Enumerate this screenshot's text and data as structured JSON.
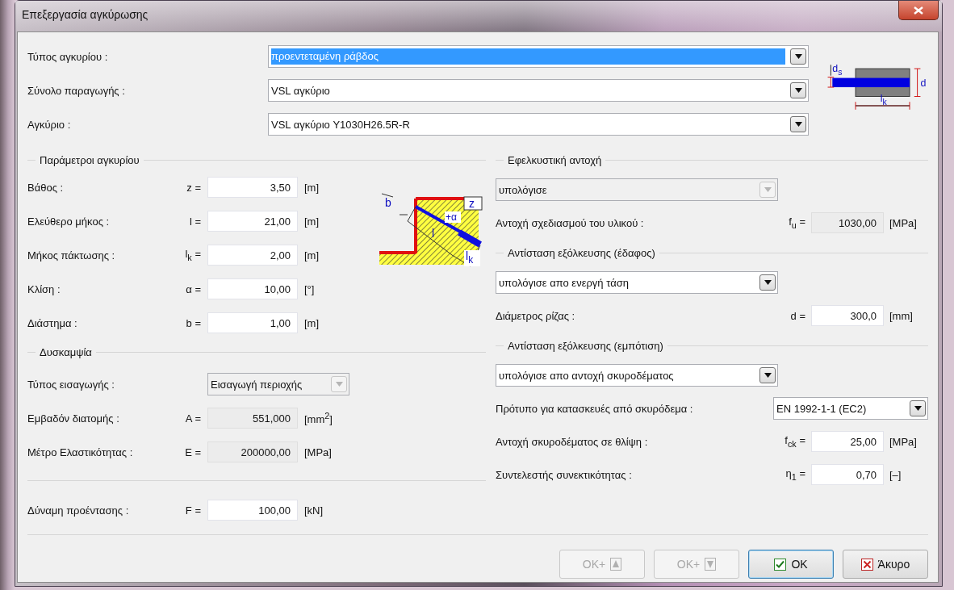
{
  "window": {
    "title": "Επεξεργασία αγκύρωσης"
  },
  "top_fields": [
    {
      "label": "Τύπος αγκυρίου :",
      "value": "προεντεταμένη ράβδος",
      "text_selected": true
    },
    {
      "label": "Σύνολο παραγωγής :",
      "value": "VSL αγκύριο",
      "text_selected": false
    },
    {
      "label": "Αγκύριο :",
      "value": "VSL αγκύριο Y1030H26.5R-R",
      "text_selected": false
    }
  ],
  "section_drawing": {
    "labels": [
      {
        "base": "d",
        "sub": "s"
      },
      {
        "base": "d"
      },
      {
        "base": "l",
        "sub": "k"
      }
    ]
  },
  "anchor_parameters": {
    "title": "Παράμετροι αγκυρίου",
    "rows": [
      {
        "label": "Βάθος :",
        "symbol": "z =",
        "value": "3,50",
        "unit": "[m]"
      },
      {
        "label": "Ελεύθερο μήκος :",
        "symbol": "l =",
        "value": "21,00",
        "unit": "[m]"
      },
      {
        "label": "Μήκος πάκτωσης :",
        "symbol": "l$_{k}$ =",
        "value": "2,00",
        "unit": "[m]"
      },
      {
        "label": "Κλίση :",
        "symbol": "α =",
        "value": "10,00",
        "unit": "[°]"
      },
      {
        "label": "Διάστημα :",
        "symbol": "b =",
        "value": "1,00",
        "unit": "[m]"
      }
    ],
    "diagram_labels": [
      {
        "base": "b"
      },
      {
        "base": "z"
      },
      {
        "base": "+α"
      },
      {
        "base": "l"
      },
      {
        "base": "l",
        "sub": "k"
      }
    ]
  },
  "stiffness": {
    "title": "Δυσκαμψία",
    "input_type": {
      "label": "Τύπος εισαγωγής :",
      "value": "Εισαγωγή περιοχής",
      "disabled": true
    },
    "rows": [
      {
        "label": "Εμβαδόν διατομής :",
        "symbol": "A =",
        "value": "551,000",
        "unit": "[mm$^{2}$]",
        "disabled": true
      },
      {
        "label": "Μέτρο Ελαστικότητας :",
        "symbol": "E =",
        "value": "200000,00",
        "unit": "[MPa]",
        "disabled": true
      }
    ]
  },
  "prestress": {
    "label": "Δύναμη προέντασης :",
    "symbol": "F =",
    "value": "100,00",
    "unit": "[kN]"
  },
  "right_sections": [
    {
      "title": "Εφελκυστική αντοχή",
      "dropdown": {
        "value": "υπολόγισε",
        "disabled": true
      },
      "rows": [
        {
          "kind": "input",
          "label": "Αντοχή σχεδιασμού του υλικού :",
          "symbol": "f$_{u}$ =",
          "value": "1030,00",
          "unit": "[MPa]",
          "disabled": true
        }
      ]
    },
    {
      "title": "Αντίσταση εξόλκευσης (έδαφος)",
      "dropdown": {
        "value": "υπολόγισε απο ενεργή τάση",
        "disabled": false
      },
      "rows": [
        {
          "kind": "input",
          "label": "Διάμετρος ρίζας :",
          "symbol": "d =",
          "value": "300,0",
          "unit": "[mm]",
          "disabled": false
        }
      ]
    },
    {
      "title": "Αντίσταση εξόλκευσης (εμπότιση)",
      "dropdown": {
        "value": "υπολόγισε απο αντοχή σκυροδέματος",
        "disabled": false
      },
      "rows": [
        {
          "kind": "dropdown",
          "label": "Πρότυπο για κατασκευές από σκυρόδεμα :",
          "value": "EN 1992-1-1 (EC2)",
          "disabled": false
        },
        {
          "kind": "input",
          "label": "Αντοχή σκυροδέματος σε θλίψη :",
          "symbol": "f$_{ck}$ =",
          "value": "25,00",
          "unit": "[MPa]",
          "disabled": false
        },
        {
          "kind": "input",
          "label": "Συντελεστής συνεκτικότητας :",
          "symbol": "η$_{1}$ =",
          "value": "0,70",
          "unit": "[–]",
          "disabled": false
        }
      ]
    }
  ],
  "buttons": [
    {
      "label": "OK+",
      "kind": "up",
      "disabled": true,
      "default": false
    },
    {
      "label": "OK+",
      "kind": "down",
      "disabled": true,
      "default": false
    },
    {
      "label": "OK",
      "kind": "check",
      "disabled": false,
      "default": true
    },
    {
      "label": "Άκυρο",
      "kind": "cross",
      "disabled": false,
      "default": false
    }
  ]
}
